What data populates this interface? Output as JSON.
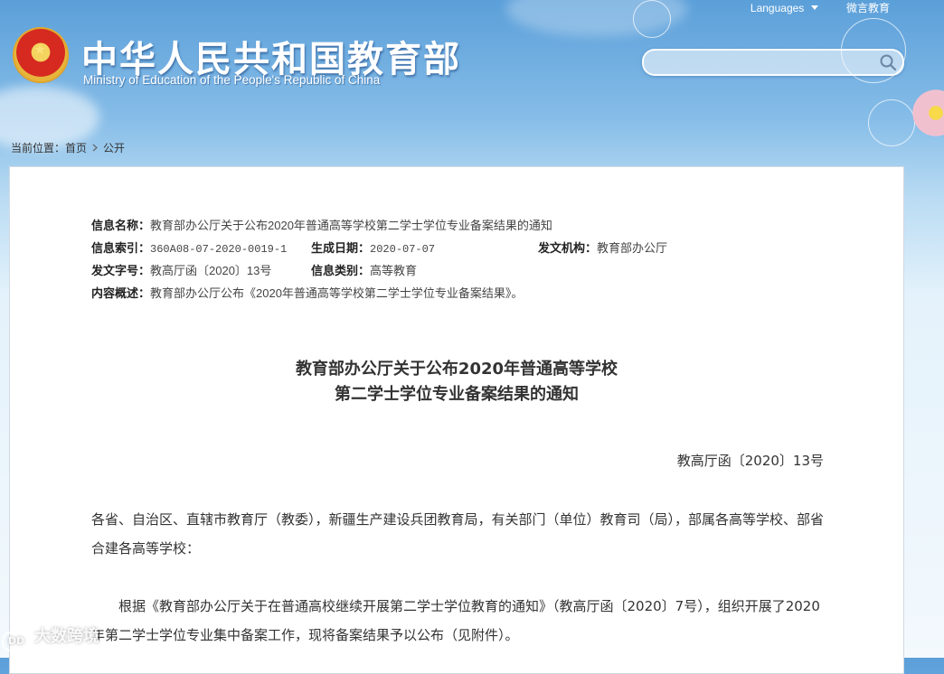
{
  "header": {
    "site_title": "中华人民共和国教育部",
    "site_subtitle": "Ministry of Education of the People's Republic of China",
    "languages_label": "Languages",
    "weibo_label": "微言教育",
    "search": {
      "placeholder": ""
    }
  },
  "breadcrumb": {
    "prefix": "当前位置：",
    "items": [
      "首页",
      "公开"
    ]
  },
  "meta": {
    "name_label": "信息名称：",
    "name_value": "教育部办公厅关于公布2020年普通高等学校第二学士学位专业备案结果的通知",
    "index_label": "信息索引：",
    "index_value": "360A08-07-2020-0019-1",
    "date_label": "生成日期：",
    "date_value": "2020-07-07",
    "org_label": "发文机构：",
    "org_value": "教育部办公厅",
    "docno_label": "发文字号：",
    "docno_value": "教高厅函〔2020〕13号",
    "category_label": "信息类别：",
    "category_value": "高等教育",
    "summary_label": "内容概述：",
    "summary_value": "教育部办公厅公布《2020年普通高等学校第二学士学位专业备案结果》。"
  },
  "document": {
    "title_line1": "教育部办公厅关于公布2020年普通高等学校",
    "title_line2": "第二学士学位专业备案结果的通知",
    "number": "教高厅函〔2020〕13号",
    "para1": "各省、自治区、直辖市教育厅（教委），新疆生产建设兵团教育局，有关部门（单位）教育司（局），部属各高等学校、部省合建各高等学校：",
    "para2": "根据《教育部办公厅关于在普通高校继续开展第二学士学位教育的通知》（教高厅函〔2020〕7号），组织开展了2020年第二学士学位专业集中备案工作，现将备案结果予以公布（见附件）。"
  },
  "watermark": {
    "text": "大数跨境",
    "logo_text": "DD"
  },
  "colors": {
    "sky_top": "#5b9fd9",
    "sky_bottom": "#f3f9fd",
    "emblem_red": "#d62a20",
    "emblem_gold": "#f4d35e"
  },
  "icons": [
    "national-emblem-icon",
    "search-icon",
    "chevron-down-icon",
    "chevron-right-icon"
  ]
}
